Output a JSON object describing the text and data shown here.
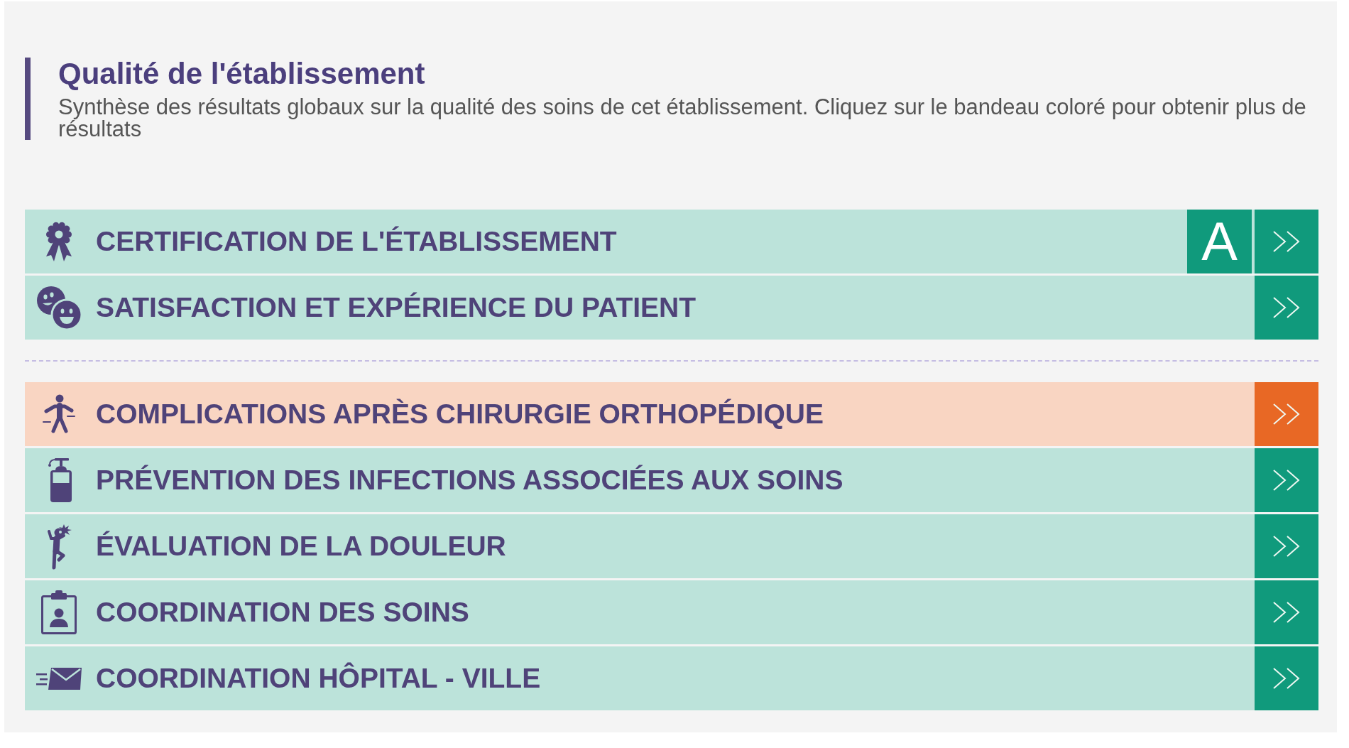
{
  "header": {
    "title": "Qualité de l'établissement",
    "subtitle": "Synthèse des résultats globaux sur la qualité des soins de cet établissement. Cliquez sur le bandeau coloré pour obtenir plus de résultats"
  },
  "groups": [
    {
      "rows": [
        {
          "label": "CERTIFICATION DE L'ÉTABLISSEMENT",
          "color": "#109a7c",
          "grade": "A"
        },
        {
          "label": "SATISFACTION ET EXPÉRIENCE DU PATIENT",
          "color": "#109a7c"
        }
      ]
    },
    {
      "rows": [
        {
          "label": "COMPLICATIONS APRÈS CHIRURGIE ORTHOPÉDIQUE",
          "color": "#e86825"
        },
        {
          "label": "PRÉVENTION DES INFECTIONS ASSOCIÉES AUX SOINS",
          "color": "#109a7c"
        },
        {
          "label": "ÉVALUATION DE LA DOULEUR",
          "color": "#109a7c"
        },
        {
          "label": "COORDINATION DES SOINS",
          "color": "#109a7c"
        },
        {
          "label": "COORDINATION HÔPITAL - VILLE",
          "color": "#109a7c"
        }
      ]
    }
  ]
}
